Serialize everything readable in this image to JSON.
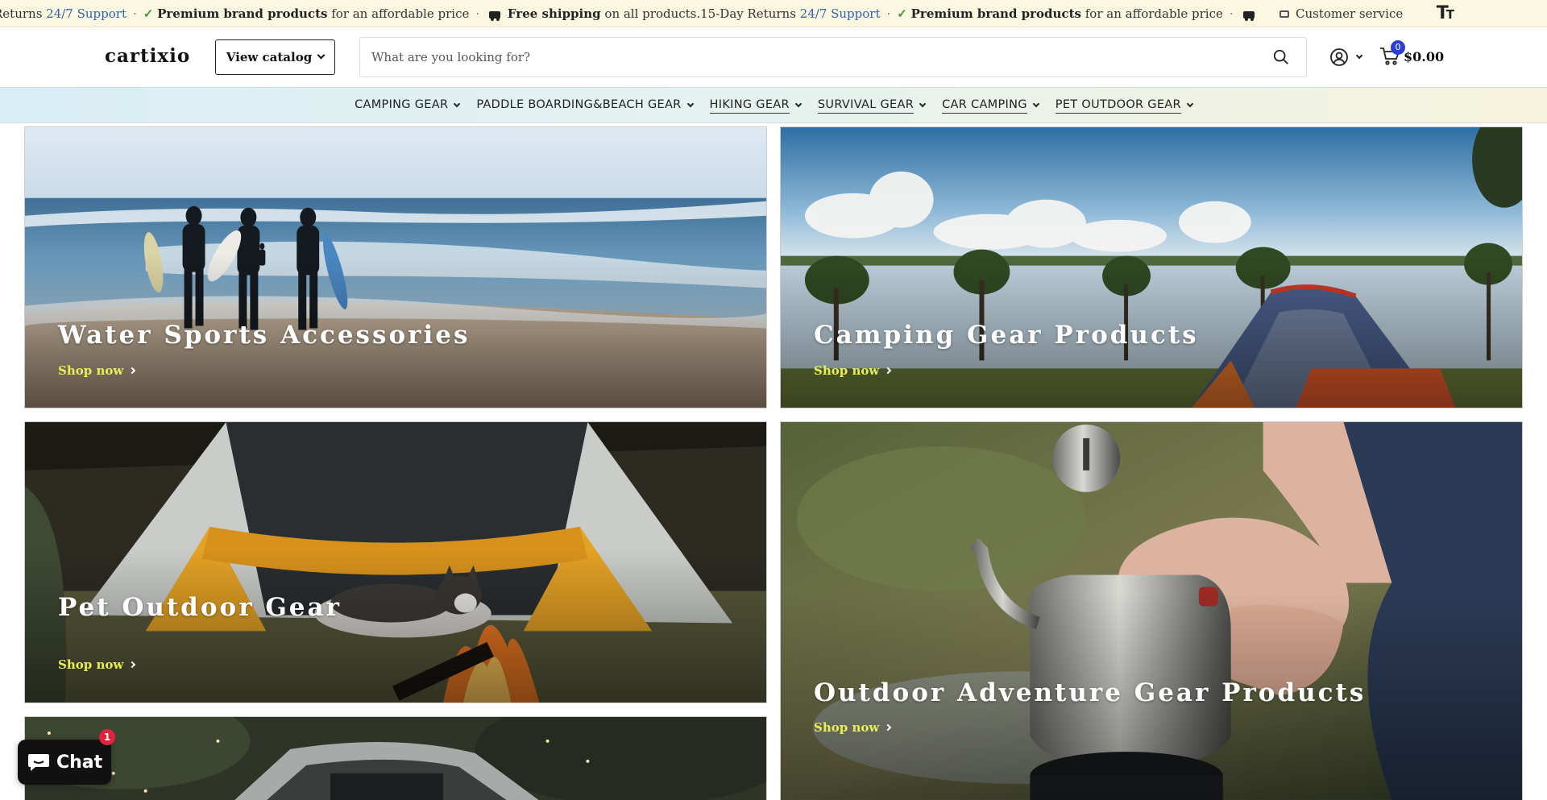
{
  "announcement": {
    "segments": [
      {
        "pre": "Returns ",
        "link": "24/7 Support"
      },
      {
        "strong": "Premium brand products",
        "rest": " for an affordable price"
      },
      {
        "strong": "Free shipping",
        "rest": " on all products.15-Day Returns ",
        "link": "24/7 Support"
      },
      {
        "strong": "Premium brand products",
        "rest": " for an affordable price"
      }
    ],
    "customer_service": "Customer service"
  },
  "header": {
    "logo": "cartixio",
    "catalog_button": "View catalog",
    "search_placeholder": "What are you looking for?",
    "cart_count": "0",
    "cart_total": "$0.00"
  },
  "nav": {
    "items": [
      {
        "label": "CAMPING GEAR"
      },
      {
        "label": "PADDLE BOARDING&BEACH GEAR"
      },
      {
        "label": "HIKING GEAR"
      },
      {
        "label": "SURVIVAL GEAR"
      },
      {
        "label": "CAR CAMPING"
      },
      {
        "label": "PET OUTDOOR GEAR"
      }
    ]
  },
  "tiles": [
    {
      "title": "Water Sports Accessories",
      "link": "Shop now"
    },
    {
      "title": "Camping Gear Products",
      "link": "Shop now"
    },
    {
      "title": "Pet Outdoor Gear",
      "link": "Shop now"
    },
    {
      "title": "Outdoor Adventure Gear Products",
      "link": "Shop now"
    }
  ],
  "chat": {
    "label": "Chat",
    "badge": "1"
  },
  "colors": {
    "accent": "#2b3fd6",
    "shop_link": "#e8ee55",
    "announcement_bg": "#fcf7e0"
  }
}
